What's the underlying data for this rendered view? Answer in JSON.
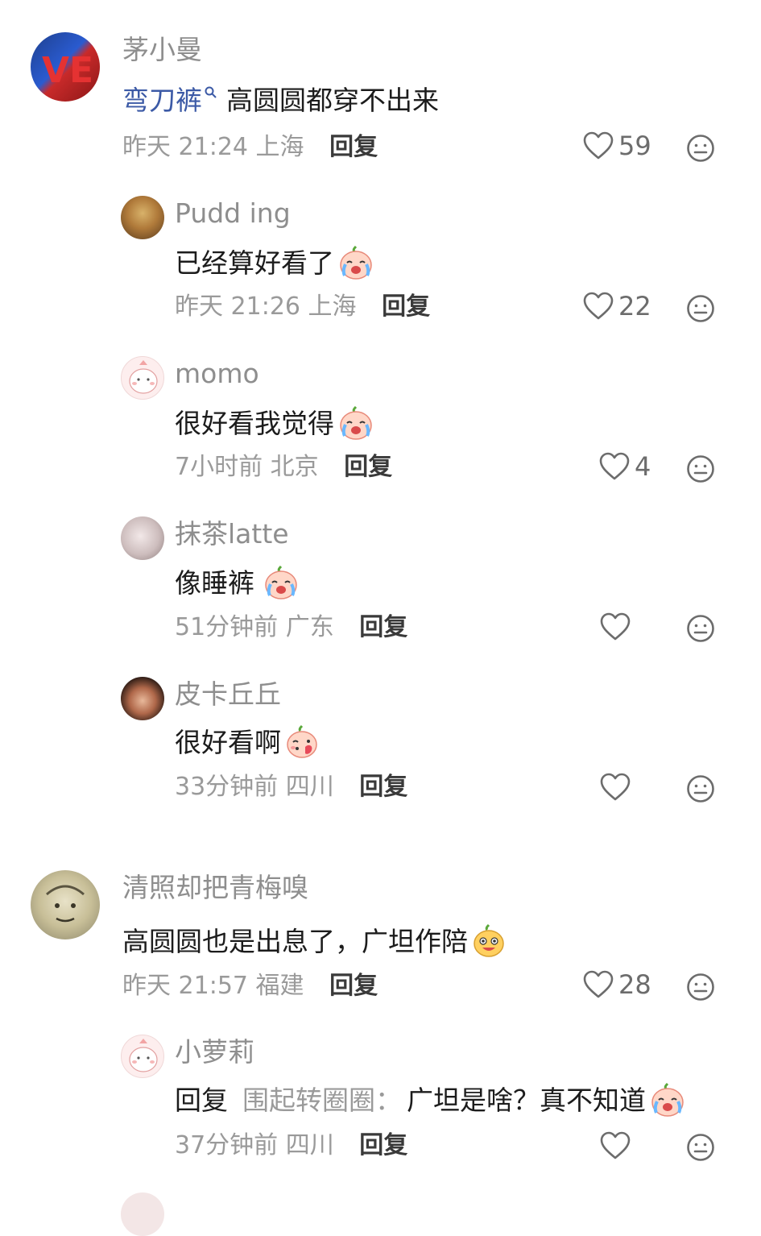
{
  "comments": [
    {
      "username": "茅小曼",
      "link_text": "弯刀裤",
      "text": "高圆圆都穿不出来",
      "time": "昨天 21:24",
      "location": "上海",
      "reply_label": "回复",
      "likes": "59",
      "replies": [
        {
          "username": "Pudd ing",
          "text": "已经算好看了",
          "time": "昨天 21:26",
          "location": "上海",
          "reply_label": "回复",
          "likes": "22"
        },
        {
          "username": "momo",
          "text": "很好看我觉得",
          "time": "7小时前",
          "location": "北京",
          "reply_label": "回复",
          "likes": "4"
        },
        {
          "username": "抹茶latte",
          "text": "像睡裤",
          "time": "51分钟前",
          "location": "广东",
          "reply_label": "回复",
          "likes": ""
        },
        {
          "username": "皮卡丘丘",
          "text": "很好看啊",
          "time": "33分钟前",
          "location": "四川",
          "reply_label": "回复",
          "likes": ""
        }
      ]
    },
    {
      "username": "清照却把青梅嗅",
      "text": "高圆圆也是出息了，广坦作陪",
      "time": "昨天 21:57",
      "location": "福建",
      "reply_label": "回复",
      "likes": "28",
      "replies": [
        {
          "username": "小萝莉",
          "reply_prefix": "回复",
          "reply_to": "围起转圈圈：",
          "text": "广坦是啥？真不知道",
          "time": "37分钟前",
          "location": "四川",
          "reply_label": "回复",
          "likes": ""
        }
      ]
    }
  ],
  "icons": {
    "like": "heart-outline-icon",
    "dislike": "meh-face-icon",
    "search": "search-icon",
    "emoji_cry": "crying-face-emoji",
    "emoji_blush": "blushing-face-emoji",
    "emoji_grin": "grinning-face-emoji"
  },
  "colors": {
    "link": "#3c5aa6",
    "meta": "#9a9a9a",
    "username": "#8e8e8e"
  }
}
